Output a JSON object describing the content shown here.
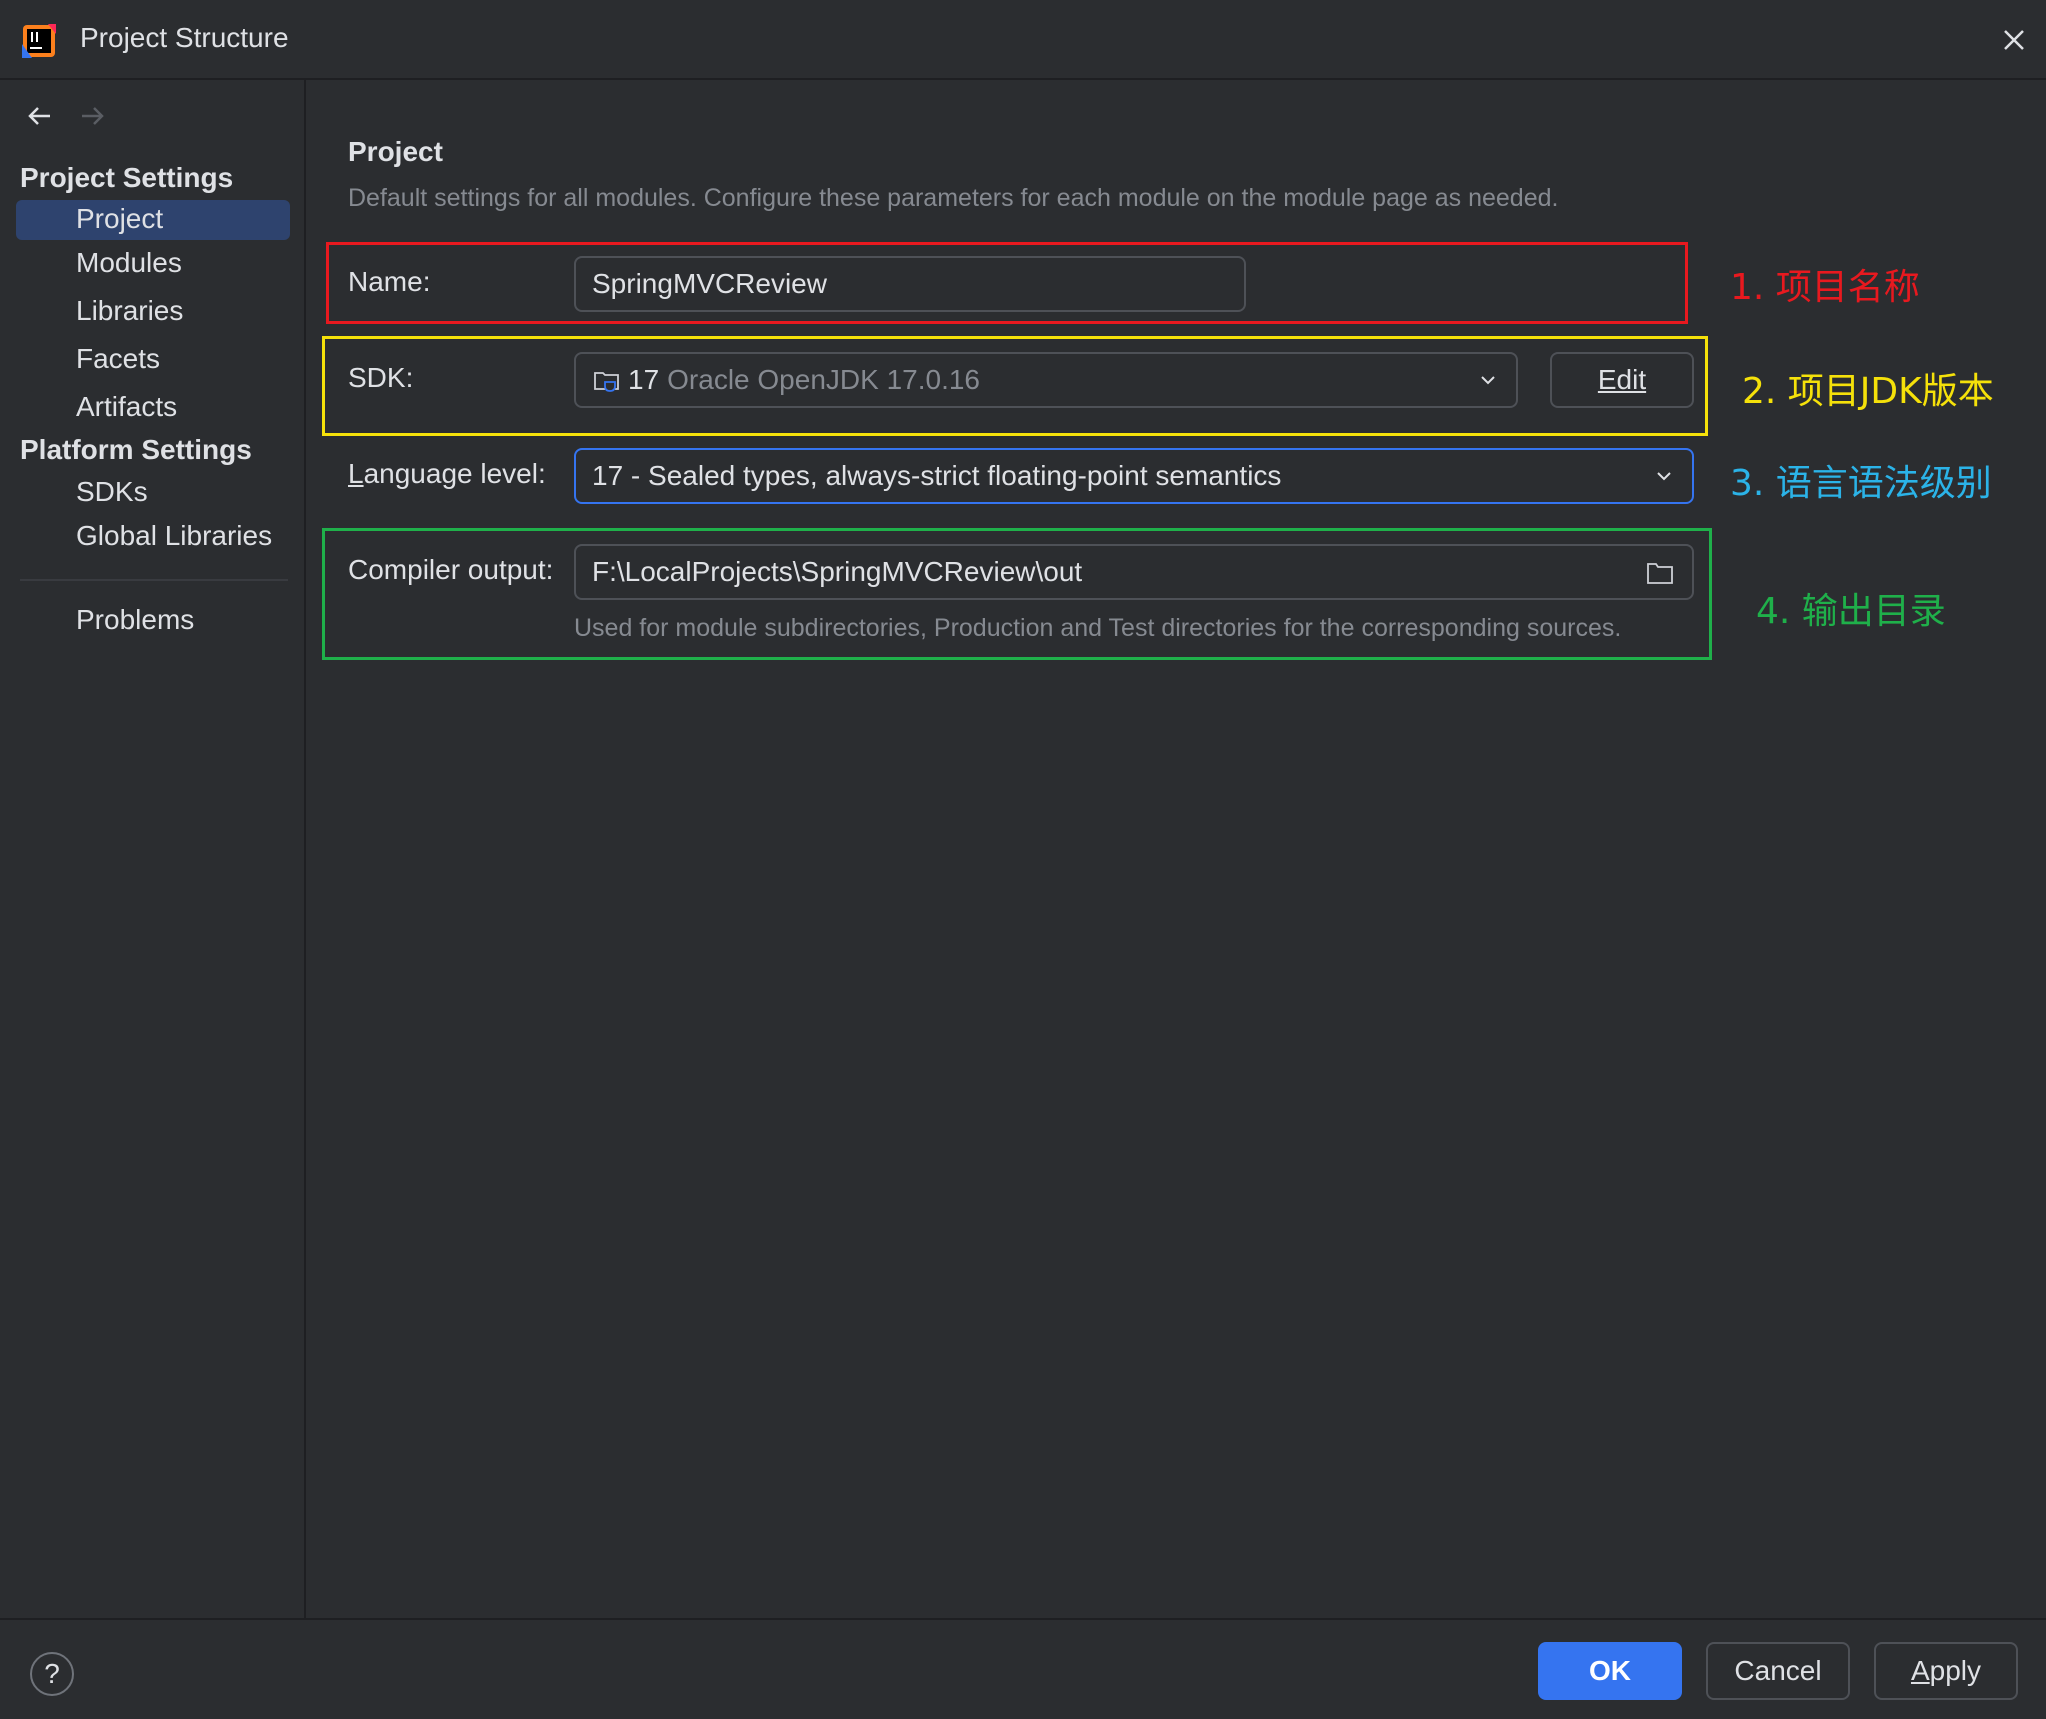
{
  "window": {
    "title": "Project Structure"
  },
  "sidebar": {
    "project_settings_header": "Project Settings",
    "project_items": [
      {
        "label": "Project",
        "selected": true
      },
      {
        "label": "Modules"
      },
      {
        "label": "Libraries"
      },
      {
        "label": "Facets"
      },
      {
        "label": "Artifacts"
      }
    ],
    "platform_settings_header": "Platform Settings",
    "platform_items": [
      {
        "label": "SDKs"
      },
      {
        "label": "Global Libraries"
      }
    ],
    "problems_label": "Problems"
  },
  "main": {
    "title": "Project",
    "description": "Default settings for all modules. Configure these parameters for each module on the module page as needed.",
    "name": {
      "label": "Name:",
      "value": "SpringMVCReview"
    },
    "sdk": {
      "label": "SDK:",
      "version": "17",
      "name": "Oracle OpenJDK 17.0.16",
      "edit_label": "Edit"
    },
    "language_level": {
      "label_first": "L",
      "label_rest": "anguage level:",
      "value": "17 - Sealed types, always-strict floating-point semantics"
    },
    "compiler_output": {
      "label": "Compiler output:",
      "value": "F:\\LocalProjects\\SpringMVCReview\\out",
      "hint": "Used for module subdirectories, Production and Test directories for the corresponding sources."
    }
  },
  "annotations": {
    "a1": "1. 项目名称",
    "a2": "2. 项目JDK版本",
    "a3": "3. 语言语法级别",
    "a4": "4. 输出目录"
  },
  "footer": {
    "help": "?",
    "ok": "OK",
    "cancel": "Cancel",
    "apply_first": "A",
    "apply_rest": "pply"
  },
  "colors": {
    "background": "#2b2d30",
    "accent": "#3574f0",
    "selected": "#2e436e",
    "annotation_red": "#e8191f",
    "annotation_yellow": "#f5e10a",
    "annotation_blue": "#2bb3e8",
    "annotation_green": "#1fb04a"
  }
}
